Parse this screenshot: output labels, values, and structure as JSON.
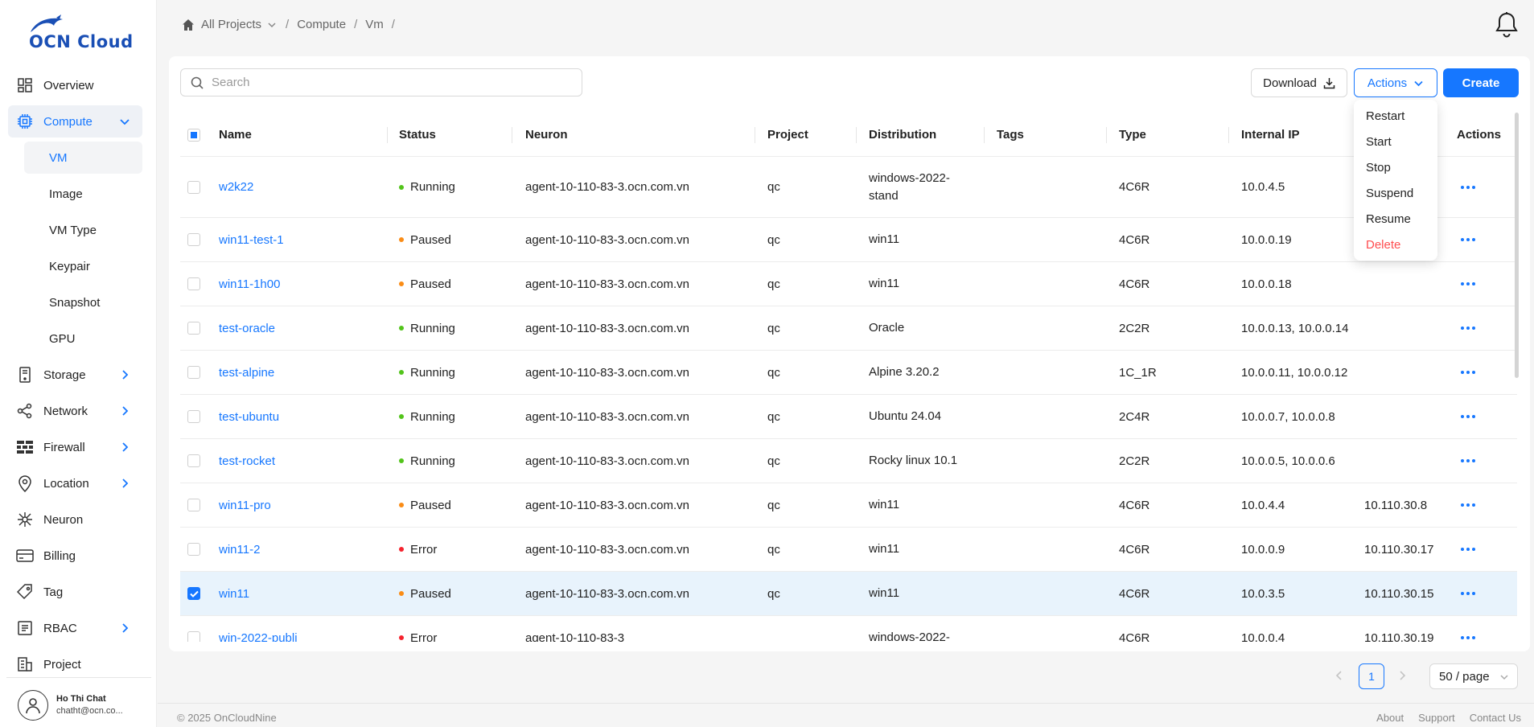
{
  "app": {
    "logo_text": "OCN Cloud"
  },
  "sidebar": {
    "items": [
      {
        "label": "Overview",
        "icon": "dashboard-icon"
      },
      {
        "label": "Compute",
        "icon": "cpu-icon"
      },
      {
        "label": "Storage",
        "icon": "storage-icon"
      },
      {
        "label": "Network",
        "icon": "share-icon"
      },
      {
        "label": "Firewall",
        "icon": "firewall-icon"
      },
      {
        "label": "Location",
        "icon": "location-icon"
      },
      {
        "label": "Neuron",
        "icon": "neuron-icon"
      },
      {
        "label": "Billing",
        "icon": "billing-icon"
      },
      {
        "label": "Tag",
        "icon": "tag-icon"
      },
      {
        "label": "RBAC",
        "icon": "rbac-icon"
      },
      {
        "label": "Project",
        "icon": "building-icon"
      }
    ],
    "compute_sub": [
      "VM",
      "Image",
      "VM Type",
      "Keypair",
      "Snapshot",
      "GPU"
    ],
    "active_sub": "VM"
  },
  "user": {
    "name": "Ho Thi Chat",
    "email": "chatht@ocn.co..."
  },
  "breadcrumb": {
    "root": "All Projects",
    "items": [
      "Compute",
      "Vm"
    ]
  },
  "toolbar": {
    "search_placeholder": "Search",
    "download_label": "Download",
    "actions_label": "Actions",
    "create_label": "Create"
  },
  "actions_menu": [
    "Restart",
    "Start",
    "Stop",
    "Suspend",
    "Resume",
    "Delete"
  ],
  "table": {
    "columns": [
      "Name",
      "Status",
      "Neuron",
      "Project",
      "Distribution",
      "Tags",
      "Type",
      "Internal IP",
      "",
      "Actions"
    ],
    "rows": [
      {
        "name": "w2k22",
        "status": "Running",
        "neuron": "agent-10-110-83-3.ocn.com.vn",
        "project": "qc",
        "distribution": "windows-2022-stand",
        "tags": "",
        "type": "4C6R",
        "internal_ip": "10.0.4.5",
        "public_ip": "",
        "checked": false
      },
      {
        "name": "win11-test-1",
        "status": "Paused",
        "neuron": "agent-10-110-83-3.ocn.com.vn",
        "project": "qc",
        "distribution": "win11",
        "tags": "",
        "type": "4C6R",
        "internal_ip": "10.0.0.19",
        "public_ip": "",
        "checked": false
      },
      {
        "name": "win11-1h00",
        "status": "Paused",
        "neuron": "agent-10-110-83-3.ocn.com.vn",
        "project": "qc",
        "distribution": "win11",
        "tags": "",
        "type": "4C6R",
        "internal_ip": "10.0.0.18",
        "public_ip": "",
        "checked": false
      },
      {
        "name": "test-oracle",
        "status": "Running",
        "neuron": "agent-10-110-83-3.ocn.com.vn",
        "project": "qc",
        "distribution": "Oracle",
        "tags": "",
        "type": "2C2R",
        "internal_ip": "10.0.0.13, 10.0.0.14",
        "public_ip": "",
        "checked": false
      },
      {
        "name": "test-alpine",
        "status": "Running",
        "neuron": "agent-10-110-83-3.ocn.com.vn",
        "project": "qc",
        "distribution": "Alpine 3.20.2",
        "tags": "",
        "type": "1C_1R",
        "internal_ip": "10.0.0.11, 10.0.0.12",
        "public_ip": "",
        "checked": false
      },
      {
        "name": "test-ubuntu",
        "status": "Running",
        "neuron": "agent-10-110-83-3.ocn.com.vn",
        "project": "qc",
        "distribution": "Ubuntu 24.04",
        "tags": "",
        "type": "2C4R",
        "internal_ip": "10.0.0.7, 10.0.0.8",
        "public_ip": "",
        "checked": false
      },
      {
        "name": "test-rocket",
        "status": "Running",
        "neuron": "agent-10-110-83-3.ocn.com.vn",
        "project": "qc",
        "distribution": "Rocky linux 10.1",
        "tags": "",
        "type": "2C2R",
        "internal_ip": "10.0.0.5, 10.0.0.6",
        "public_ip": "",
        "checked": false
      },
      {
        "name": "win11-pro",
        "status": "Paused",
        "neuron": "agent-10-110-83-3.ocn.com.vn",
        "project": "qc",
        "distribution": "win11",
        "tags": "",
        "type": "4C6R",
        "internal_ip": "10.0.4.4",
        "public_ip": "10.110.30.8",
        "checked": false
      },
      {
        "name": "win11-2",
        "status": "Error",
        "neuron": "agent-10-110-83-3.ocn.com.vn",
        "project": "qc",
        "distribution": "win11",
        "tags": "",
        "type": "4C6R",
        "internal_ip": "10.0.0.9",
        "public_ip": "10.110.30.17",
        "checked": false
      },
      {
        "name": "win11",
        "status": "Paused",
        "neuron": "agent-10-110-83-3.ocn.com.vn",
        "project": "qc",
        "distribution": "win11",
        "tags": "",
        "type": "4C6R",
        "internal_ip": "10.0.3.5",
        "public_ip": "10.110.30.15",
        "checked": true
      },
      {
        "name": "win-2022-publi",
        "status": "Error",
        "neuron": "agent-10-110-83-3",
        "project": "",
        "distribution": "windows-2022-",
        "tags": "",
        "type": "4C6R",
        "internal_ip": "10.0.0.4",
        "public_ip": "10.110.30.19",
        "checked": false
      }
    ]
  },
  "status_colors": {
    "Running": "#52c41a",
    "Paused": "#fa8c16",
    "Error": "#f5222d"
  },
  "pagination": {
    "current_page": "1",
    "page_size": "50 / page"
  },
  "footer": {
    "copyright": "© 2025 OnCloudNine",
    "links": [
      "About",
      "Support",
      "Contact Us"
    ]
  }
}
